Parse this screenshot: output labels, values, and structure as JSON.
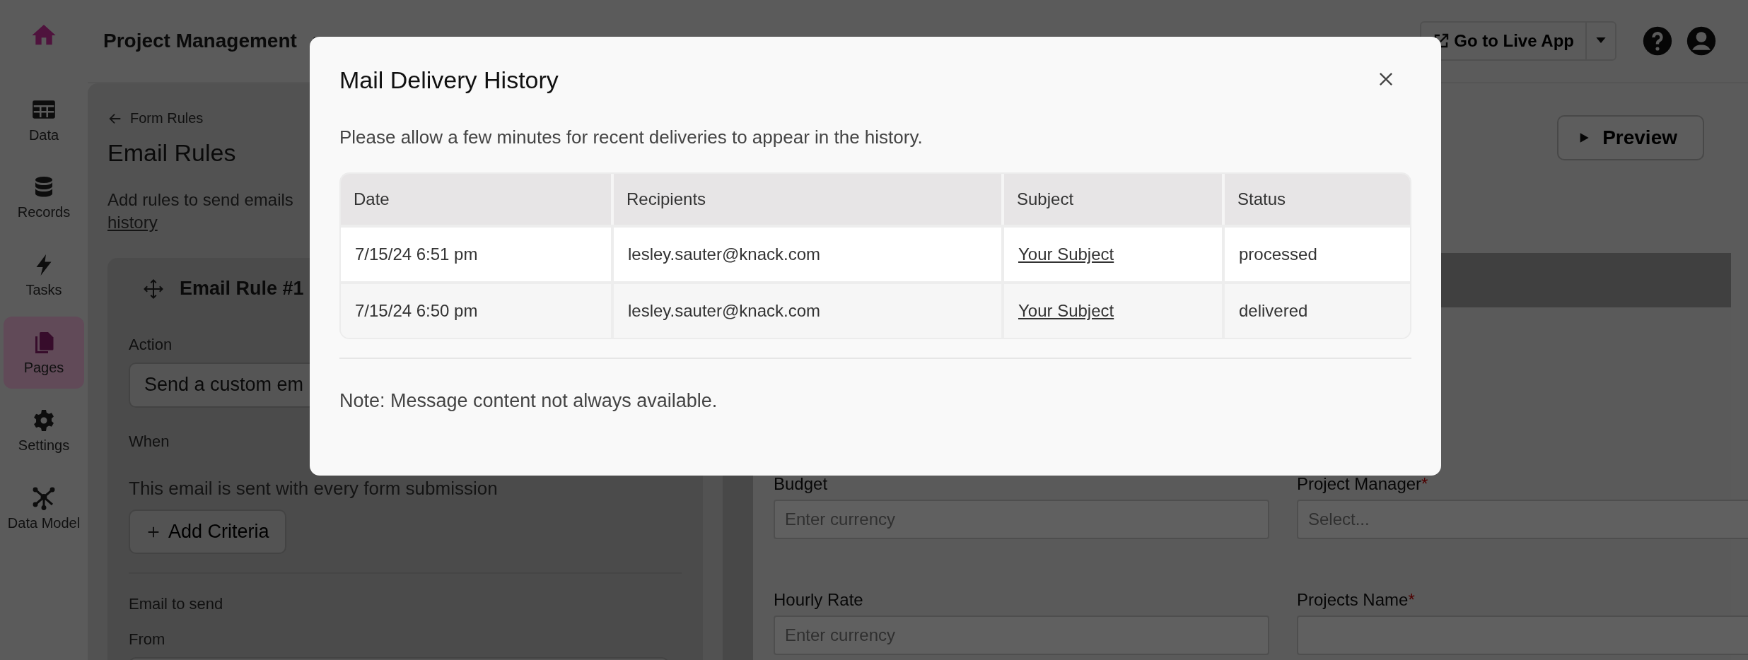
{
  "top_bar": {
    "app_name": "Project Management",
    "live_app_button": "Go to Live App"
  },
  "sidebar": {
    "items": [
      {
        "label": "Data",
        "kind": "table",
        "selected": false
      },
      {
        "label": "Records",
        "kind": "database",
        "selected": false
      },
      {
        "label": "Tasks",
        "kind": "bolt",
        "selected": false
      },
      {
        "label": "Pages",
        "kind": "pages",
        "selected": true
      },
      {
        "label": "Settings",
        "kind": "gear",
        "selected": false
      },
      {
        "label": "Data Model",
        "kind": "network",
        "selected": false
      }
    ]
  },
  "rules_panel": {
    "back_link": "Form Rules",
    "title": "Email Rules",
    "description": "Add rules to send emails",
    "history_link": "history",
    "rule": {
      "title": "Email Rule #1",
      "action_label": "Action",
      "action_value": "Send a custom em",
      "when_label": "When",
      "when_text": "This email is sent with every form submission",
      "add_criteria_button": "Add Criteria",
      "email_section_label": "Email to send",
      "from_label": "From"
    }
  },
  "preview_button": "Preview",
  "required_mark": "*",
  "form_fields": [
    {
      "label": "Budget",
      "required": false,
      "placeholder": "Enter currency"
    },
    {
      "label": "Project Manager",
      "required": true,
      "placeholder": "Select..."
    },
    {
      "label": "Hourly Rate",
      "required": false,
      "placeholder": "Enter currency"
    },
    {
      "label": "Projects Name",
      "required": true
    }
  ],
  "modal": {
    "title": "Mail Delivery History",
    "intro": "Please allow a few minutes for recent deliveries to appear in the history.",
    "columns": [
      "Date",
      "Recipients",
      "Subject",
      "Status"
    ],
    "rows": [
      {
        "date": "7/15/24 6:51 pm",
        "recipients": "lesley.sauter@knack.com",
        "subject": "Your Subject",
        "status": "processed"
      },
      {
        "date": "7/15/24 6:50 pm",
        "recipients": "lesley.sauter@knack.com",
        "subject": "Your Subject",
        "status": "delivered"
      }
    ],
    "note": "Note: Message content not always available."
  }
}
